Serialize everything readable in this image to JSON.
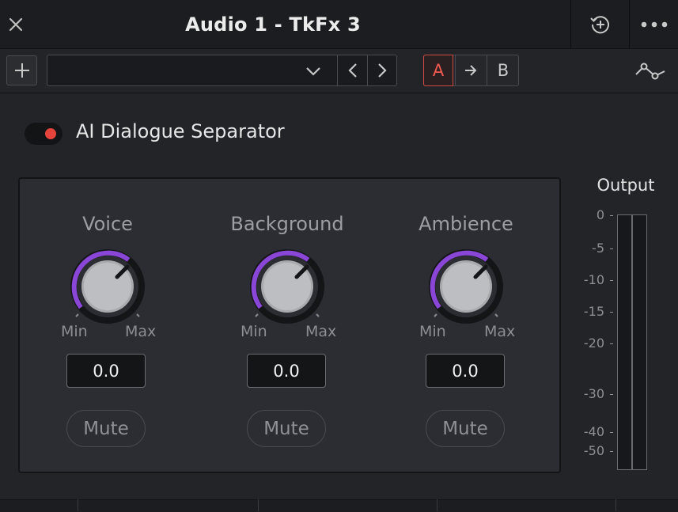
{
  "window": {
    "title": "Audio 1 - TkFx 3",
    "close_icon": "close-icon",
    "history_icon": "history-add-icon",
    "more_icon": "more-dots-icon"
  },
  "toolbar": {
    "add_icon": "plus-icon",
    "preset_value": "",
    "dropdown_icon": "chevron-down-icon",
    "prev_icon": "chevron-left-icon",
    "next_icon": "chevron-right-icon",
    "compare": {
      "a_label": "A",
      "copy_icon": "arrow-right-icon",
      "b_label": "B"
    },
    "automation_icon": "automation-curve-icon"
  },
  "plugin": {
    "name": "AI Dialogue Separator",
    "enabled": true,
    "accent_color": "#e5433b"
  },
  "channels": [
    {
      "label": "Voice",
      "min_label": "Min",
      "max_label": "Max",
      "value": "0.0",
      "mute_label": "Mute"
    },
    {
      "label": "Background",
      "min_label": "Min",
      "max_label": "Max",
      "value": "0.0",
      "mute_label": "Mute"
    },
    {
      "label": "Ambience",
      "min_label": "Min",
      "max_label": "Max",
      "value": "0.0",
      "mute_label": "Mute"
    }
  ],
  "knob_color": "#8a46d6",
  "output": {
    "label": "Output",
    "ticks": [
      "0",
      "-5",
      "-10",
      "-15",
      "-20",
      "-30",
      "-40",
      "-50"
    ]
  }
}
